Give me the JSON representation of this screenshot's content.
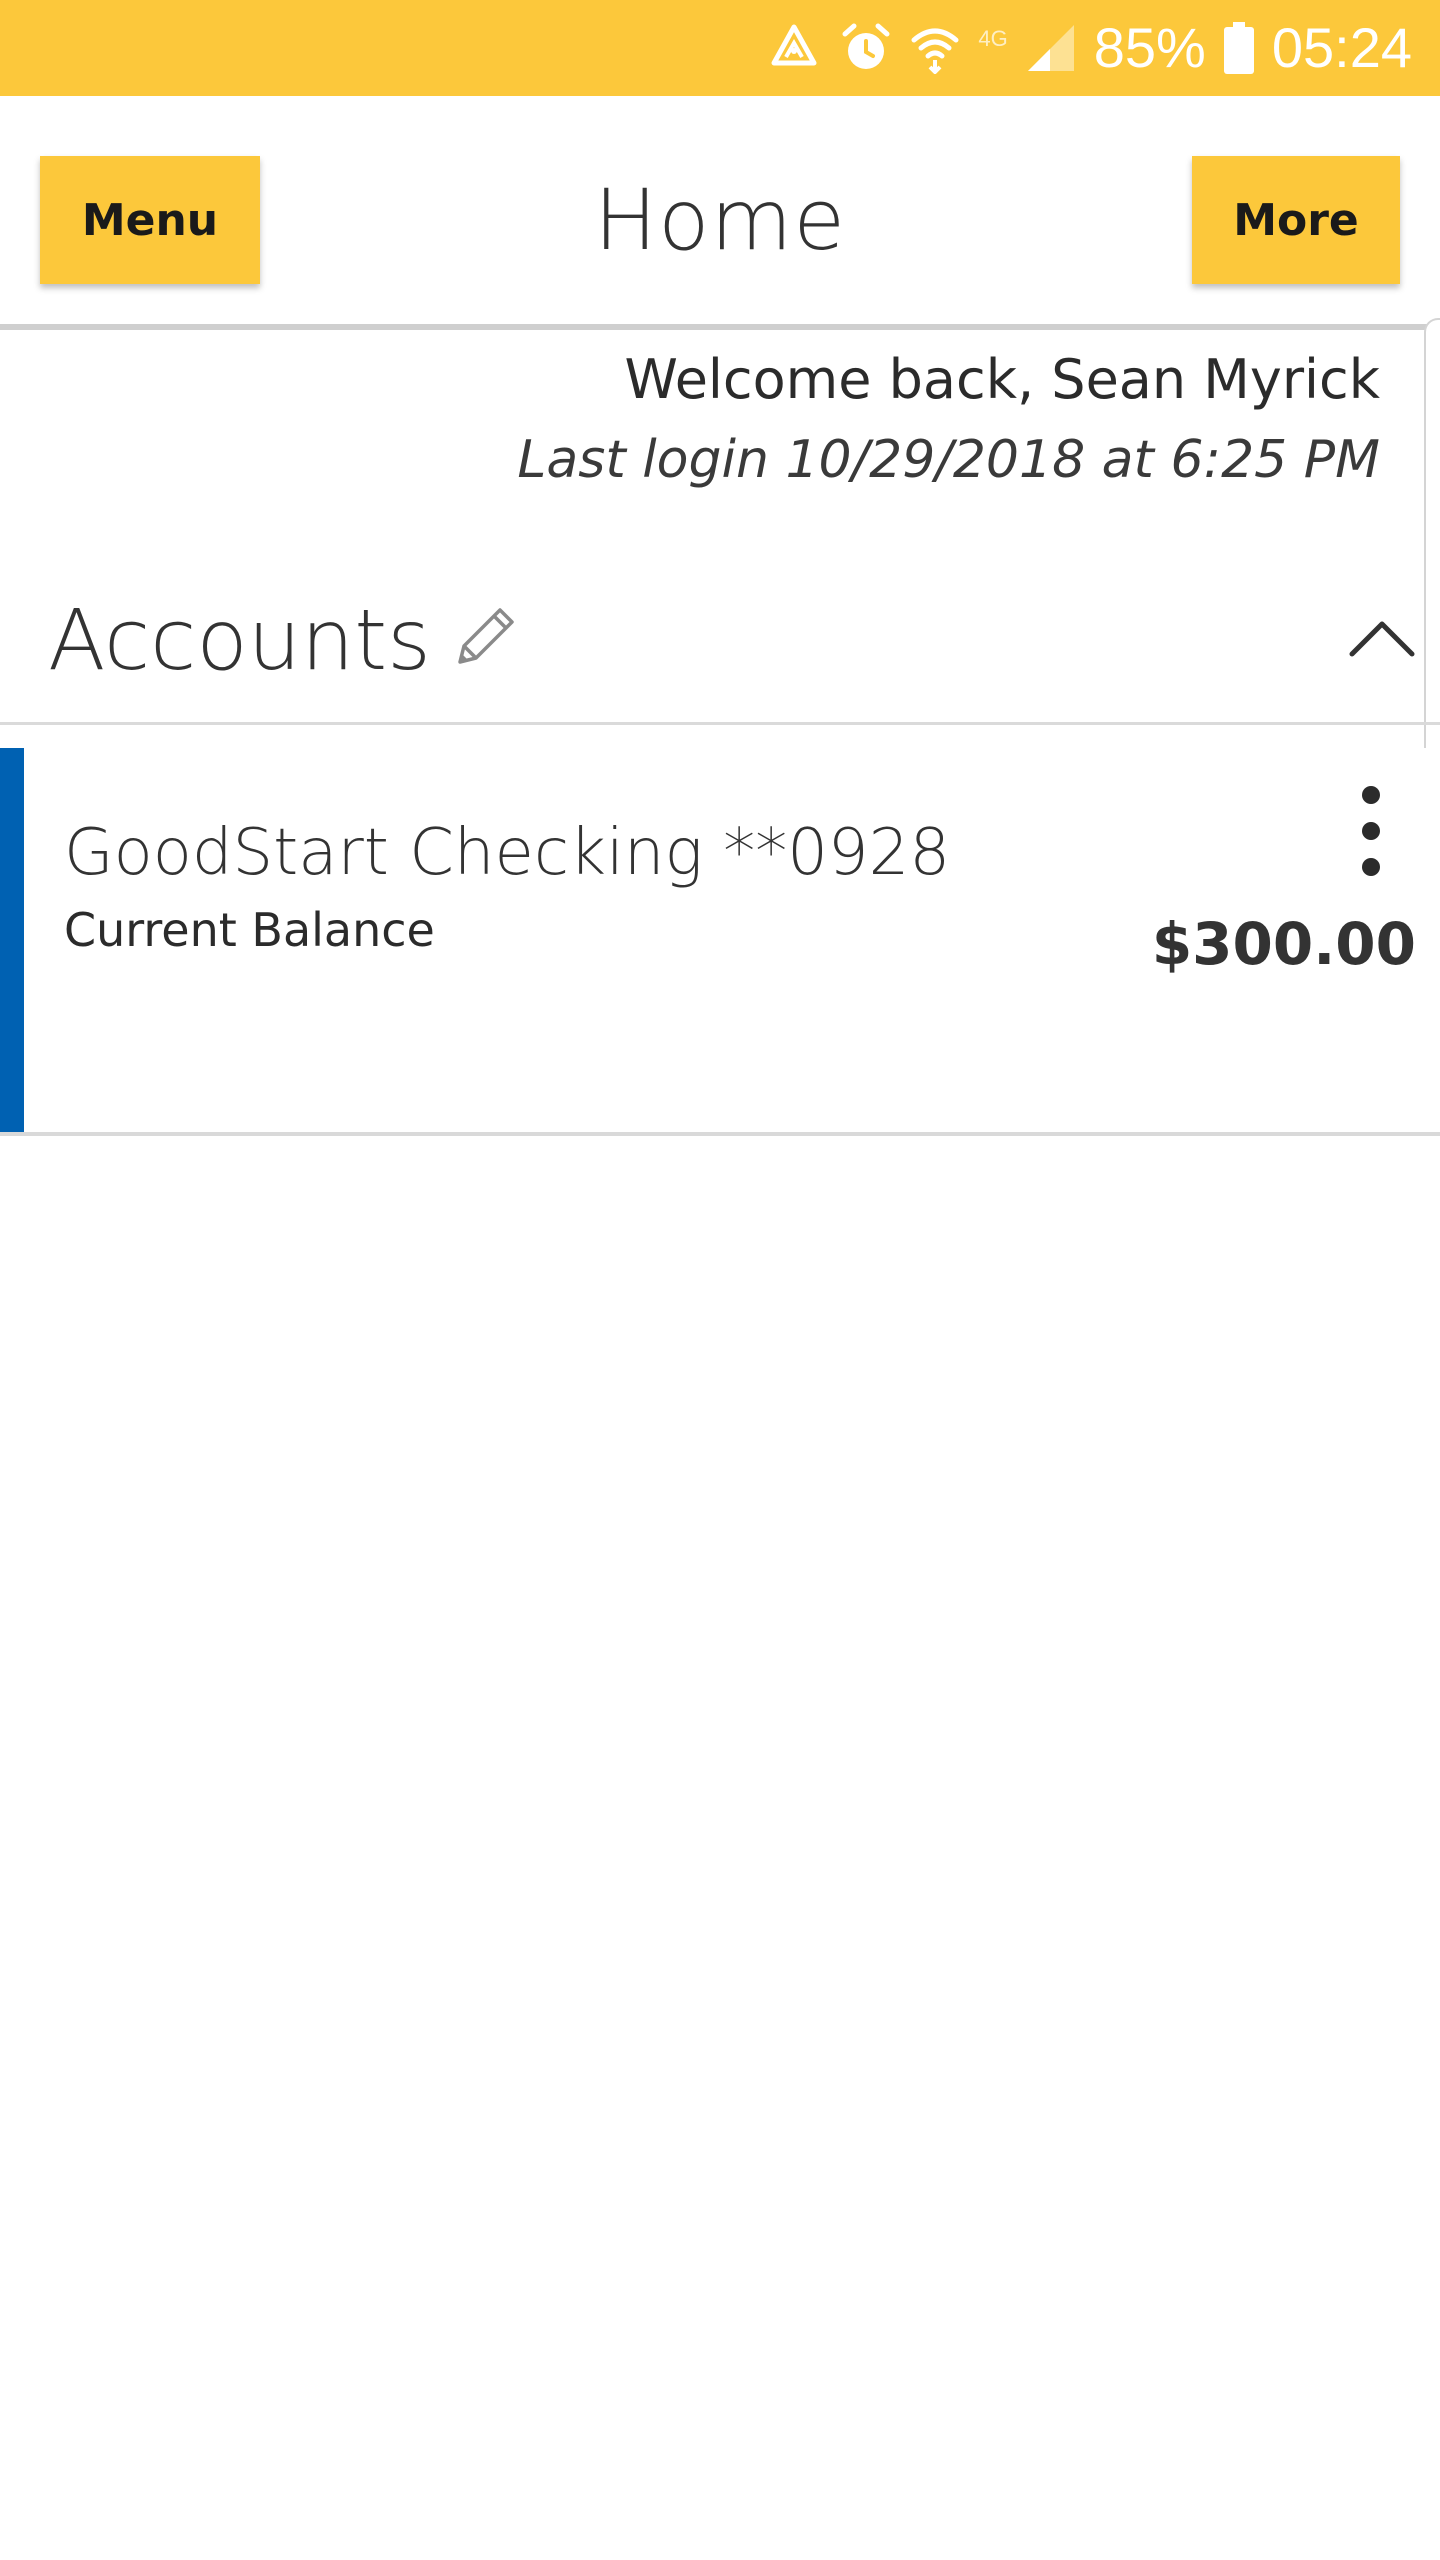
{
  "status_bar": {
    "battery_percent": "85%",
    "time": "05:24",
    "network_label": "4G",
    "icons": [
      "recycle-alert-icon",
      "alarm-icon",
      "wifi-icon",
      "signal-icon",
      "battery-icon"
    ],
    "background": "#fcc83b"
  },
  "header": {
    "menu_label": "Menu",
    "title": "Home",
    "more_label": "More",
    "button_color": "#fcc83b"
  },
  "welcome": {
    "greeting": "Welcome back, Sean Myrick",
    "last_login": "Last login 10/29/2018 at 6:25 PM"
  },
  "accounts": {
    "title": "Accounts",
    "edit_icon": "pencil-icon",
    "collapse_icon": "chevron-up-icon",
    "items": [
      {
        "name": "GoodStart Checking **0928",
        "balance_label": "Current Balance",
        "balance": "$300.00",
        "accent_color": "#0061b2",
        "menu_icon": "kebab-menu-icon"
      }
    ]
  }
}
